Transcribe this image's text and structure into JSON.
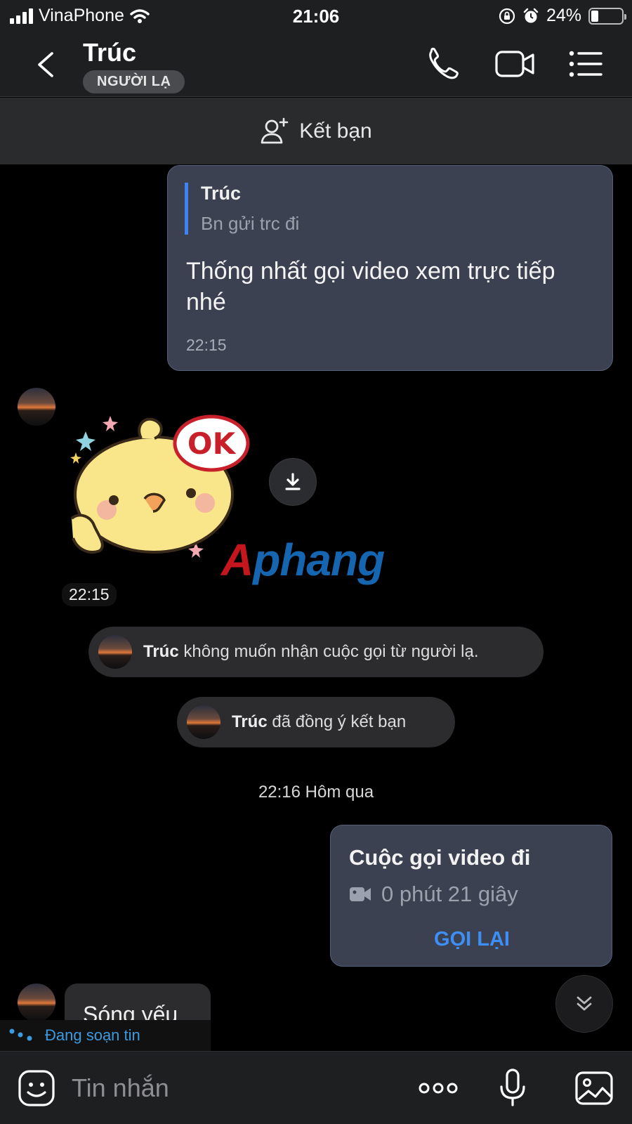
{
  "status_bar": {
    "carrier": "VinaPhone",
    "time": "21:06",
    "battery": "24%",
    "battery_level": 0.24
  },
  "header": {
    "contact_name": "Trúc",
    "badge": "NGƯỜI LẠ"
  },
  "add_friend": {
    "label": "Kết bạn"
  },
  "quoted_message": {
    "quote_author": "Trúc",
    "quote_text": "Bn gửi trc đi",
    "text": "Thống nhất gọi video xem trực tiếp nhé",
    "time": "22:15"
  },
  "sticker_message": {
    "sticker_text": "OK",
    "time": "22:15"
  },
  "watermark": {
    "part_a": "A",
    "part_b": "phang"
  },
  "system_messages": [
    {
      "name": "Trúc",
      "text": " không muốn nhận cuộc gọi từ người lạ."
    },
    {
      "name": "Trúc",
      "text": " đã đồng ý kết bạn"
    }
  ],
  "date_separator": "22:16 Hôm qua",
  "call_card": {
    "title": "Cuộc gọi video đi",
    "duration": "0 phút 21 giây",
    "action": "GỌI LẠI"
  },
  "incoming_message": {
    "text": "Sóng yếu"
  },
  "typing_indicator": {
    "text": "Đang soạn tin"
  },
  "composer": {
    "placeholder": "Tin nhắn"
  },
  "colors": {
    "accent": "#3d8ff5",
    "bubble_out": "#3b4150",
    "bar": "#1e1f21",
    "typing": "#3b9ae0"
  }
}
